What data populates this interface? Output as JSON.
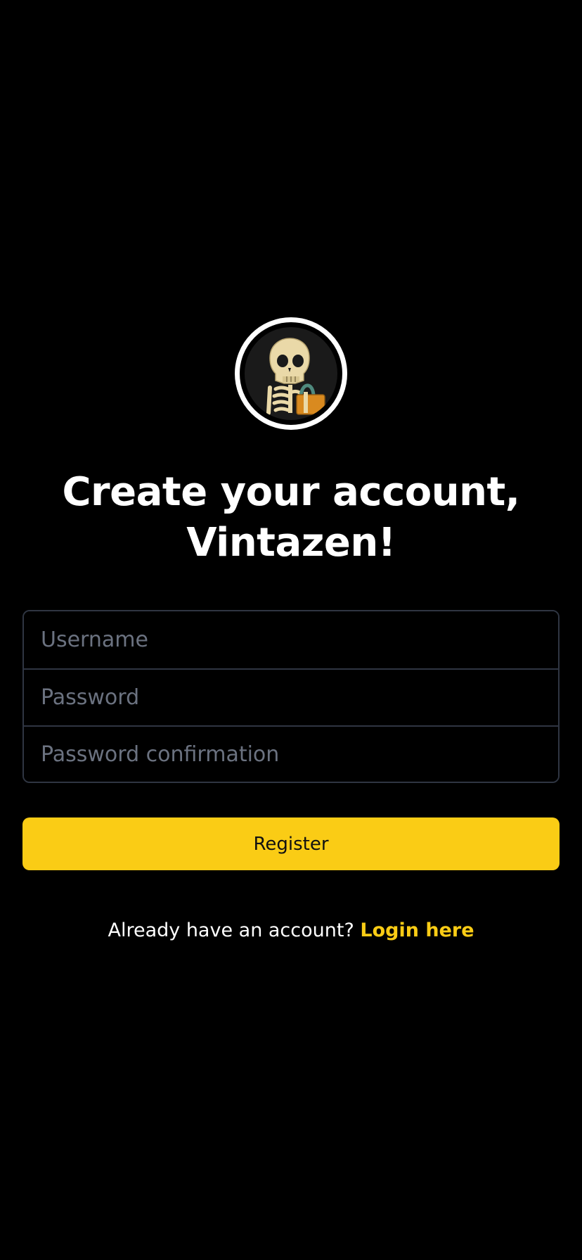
{
  "header": {
    "avatar_icon": "skeleton-with-bag-icon",
    "title_line1": "Create your account,",
    "title_line2": "Vintazen!"
  },
  "form": {
    "username": {
      "value": "",
      "placeholder": "Username"
    },
    "password": {
      "value": "",
      "placeholder": "Password"
    },
    "password_confirmation": {
      "value": "",
      "placeholder": "Password confirmation"
    },
    "register_label": "Register"
  },
  "footer": {
    "prompt": "Already have an account?",
    "login_link": "Login here"
  },
  "colors": {
    "background": "#000000",
    "accent": "#facc15",
    "border": "#2f3542",
    "placeholder": "#6b7280"
  }
}
